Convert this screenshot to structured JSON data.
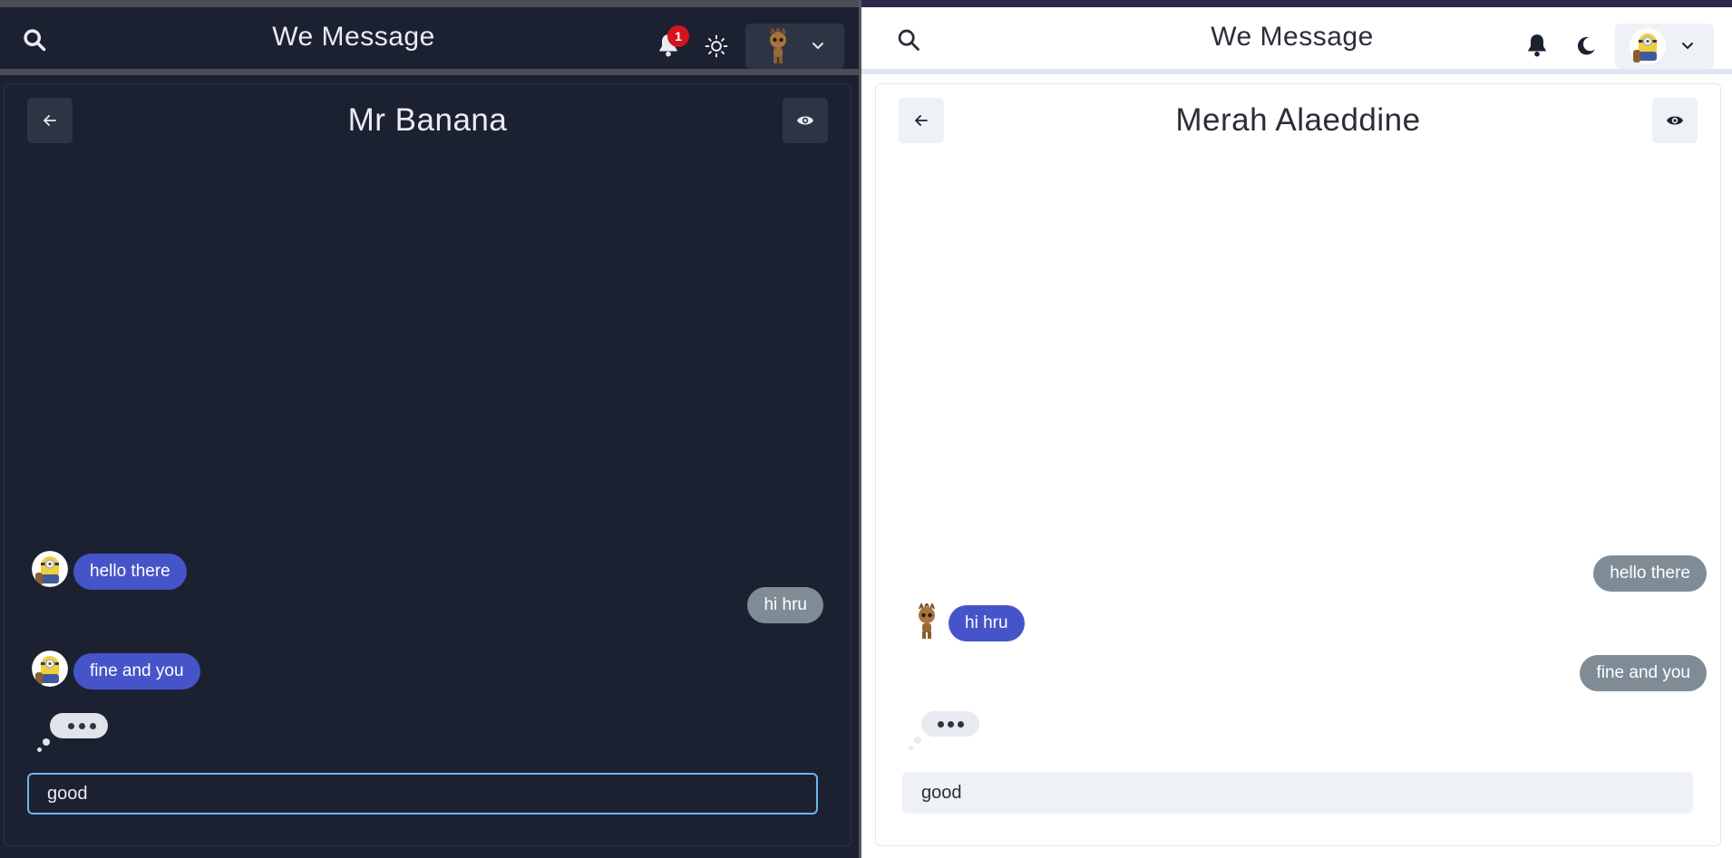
{
  "left": {
    "navbar": {
      "brand": "We Message",
      "notification_count": "1",
      "theme_icon": "sun-icon",
      "avatar": "groot-avatar"
    },
    "chat": {
      "title": "Mr Banana",
      "messages": [
        {
          "text": "hello there",
          "side": "incoming",
          "color": "#4654c9"
        },
        {
          "text": "hi hru",
          "side": "outgoing",
          "color": "#7f8c96"
        },
        {
          "text": "fine and you",
          "side": "incoming",
          "color": "#4654c9"
        }
      ],
      "typing_indicator": true,
      "input_value": "good"
    }
  },
  "right": {
    "navbar": {
      "brand": "We Message",
      "theme_icon": "moon-icon",
      "avatar": "minion-avatar"
    },
    "chat": {
      "title": "Merah Alaeddine",
      "messages": [
        {
          "text": "hello there",
          "side": "outgoing",
          "color": "#7f8c96"
        },
        {
          "text": "hi hru",
          "side": "incoming",
          "color": "#4654c9"
        },
        {
          "text": "fine and you",
          "side": "outgoing",
          "color": "#7f8c96"
        }
      ],
      "typing_indicator": true,
      "input_value": "good"
    }
  },
  "colors": {
    "dark_bg": "#1c2131",
    "dark_button": "#2d3443",
    "light_button": "#eef1f6",
    "incoming_bubble": "#4654c9",
    "outgoing_bubble": "#7f8c96",
    "badge": "#d4141c",
    "input_focus": "#6ab6ee"
  }
}
